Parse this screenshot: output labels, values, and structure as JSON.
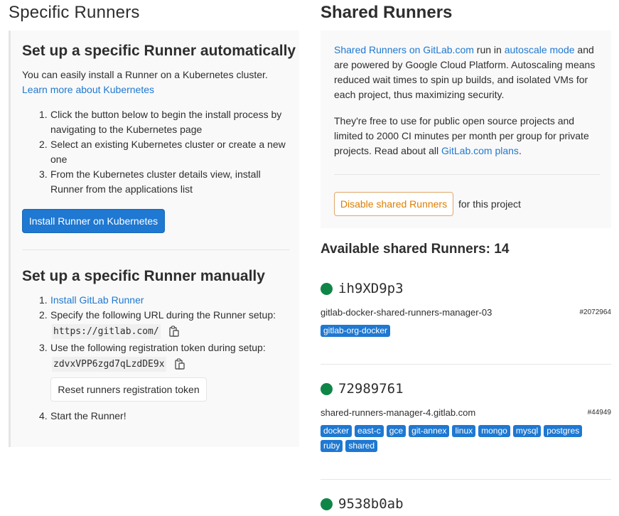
{
  "specific": {
    "title": "Specific Runners",
    "auto_title": "Set up a specific Runner automatically",
    "auto_desc": "You can easily install a Runner on a Kubernetes cluster.",
    "auto_link": "Learn more about Kubernetes",
    "auto_steps": [
      "Click the button below to begin the install process by navigating to the Kubernetes page",
      "Select an existing Kubernetes cluster or create a new one",
      "From the Kubernetes cluster details view, install Runner from the applications list"
    ],
    "install_button": "Install Runner on Kubernetes",
    "manual_title": "Set up a specific Runner manually",
    "manual_step1_link": "Install GitLab Runner",
    "manual_step2": "Specify the following URL during the Runner setup:",
    "url": "https://gitlab.com/",
    "manual_step3": "Use the following registration token during setup:",
    "token": "zdvxVPP6zgd7qLzdDE9x",
    "reset_button": "Reset runners registration token",
    "manual_step4": "Start the Runner!"
  },
  "shared": {
    "title": "Shared Runners",
    "desc1_link1": "Shared Runners on GitLab.com",
    "desc1_text1": " run in ",
    "desc1_link2": "autoscale mode",
    "desc1_text2": " and are powered by Google Cloud Platform. Autoscaling means reduced wait times to spin up builds, and isolated VMs for each project, thus maximizing security.",
    "desc2_text": "They're free to use for public open source projects and limited to 2000 CI minutes per month per group for private projects. Read about all ",
    "desc2_link": "GitLab.com plans",
    "desc2_end": ".",
    "disable_button": "Disable shared Runners",
    "for_project": "for this project",
    "available_title": "Available shared Runners: 14",
    "runners": [
      {
        "id": "ih9XD9p3",
        "desc": "gitlab-docker-shared-runners-manager-03",
        "num": "#2072964",
        "tags": [
          "gitlab-org-docker"
        ]
      },
      {
        "id": "72989761",
        "desc": "shared-runners-manager-4.gitlab.com",
        "num": "#44949",
        "tags": [
          "docker",
          "east-c",
          "gce",
          "git-annex",
          "linux",
          "mongo",
          "mysql",
          "postgres",
          "ruby",
          "shared"
        ]
      },
      {
        "id": "9538b0ab"
      }
    ]
  },
  "colors": {
    "primary": "#1f78d1",
    "online_dot": "#108548",
    "warning": "#de7e00"
  }
}
